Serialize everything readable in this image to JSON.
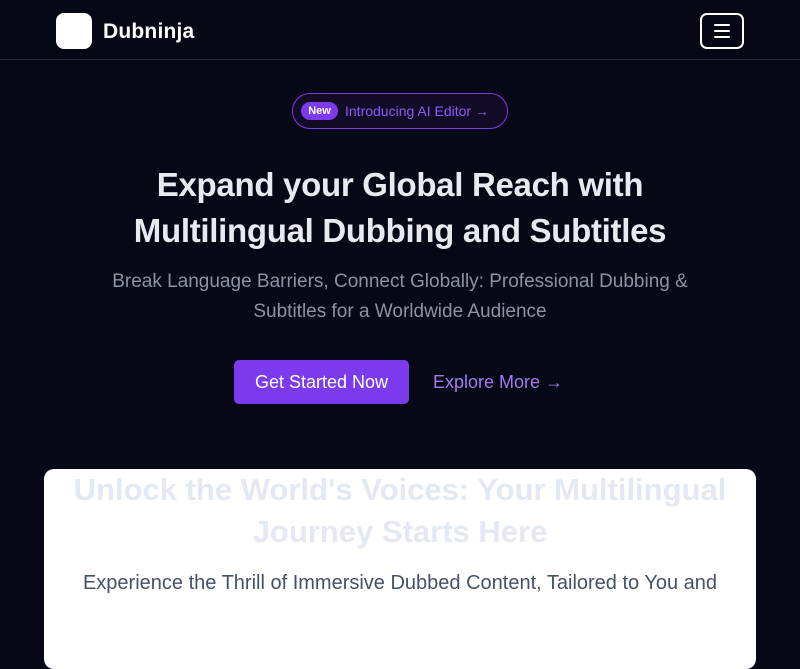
{
  "nav": {
    "brand": "Dubninja",
    "menu_icon": "hamburger-menu-icon"
  },
  "hero": {
    "badge": "New",
    "announcement": "Introducing AI Editor →",
    "title_line1": "Expand your Global Reach with",
    "title_line2": "Multilingual Dubbing and Subtitles",
    "subtitle_line1": "Break Language Barriers, Connect Globally: Professional Dubbing &",
    "subtitle_line2": "Subtitles for a Worldwide Audience",
    "primary_cta": "Get Started Now",
    "secondary_cta": "Explore More →"
  },
  "section": {
    "title_line1": "Unlock the World's Voices: Your Multilingual",
    "title_line2": "Journey Starts Here",
    "subtitle": "Experience the Thrill of Immersive Dubbed Content, Tailored to You and"
  },
  "colors": {
    "background": "#070816",
    "accent": "#7c3aed",
    "text_light": "#e8eaf0",
    "text_muted": "#8b93a5"
  }
}
